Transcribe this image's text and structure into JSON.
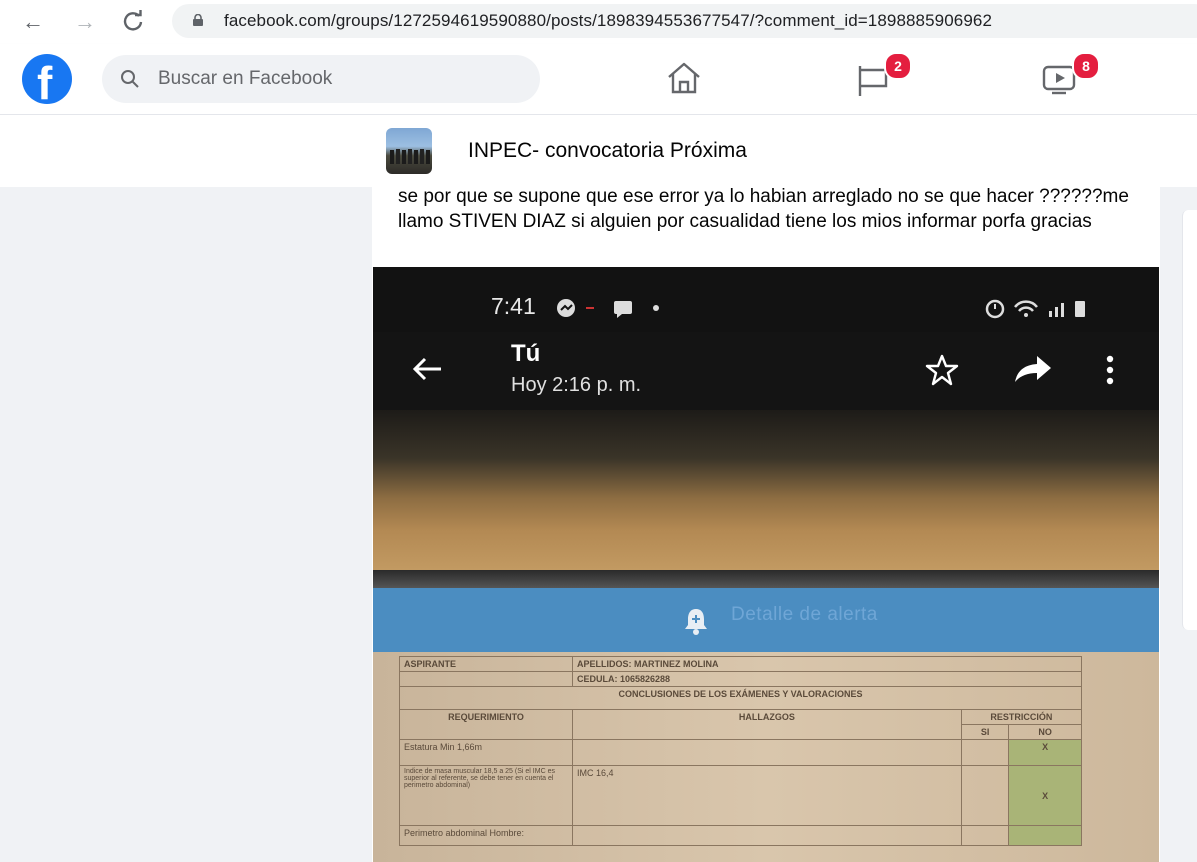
{
  "browser": {
    "url": "facebook.com/groups/1272594619590880/posts/1898394553677547/?comment_id=1898885906962"
  },
  "header": {
    "search_placeholder": "Buscar en Facebook",
    "flag_badge": "2",
    "watch_badge": "8",
    "colors": {
      "brand": "#1877f2",
      "badge": "#e41e3f"
    }
  },
  "group": {
    "title": "INPEC- convocatoria Próxima"
  },
  "post": {
    "text": "se por que se supone que ese error ya lo habian arreglado no se que hacer ??????me llamo STIVEN DIAZ si alguien por casualidad tiene los mios informar porfa gracias"
  },
  "photo": {
    "status_time": "7:41",
    "chat_name": "Tú",
    "chat_time": "Hoy 2:16 p. m.",
    "band_label": "Detalle de alerta",
    "doc": {
      "aspirante_label": "ASPIRANTE",
      "apellidos": "APELLIDOS: MARTINEZ MOLINA",
      "cedula": "CEDULA: 1065826288",
      "conclusiones": "CONCLUSIONES DE LOS EXÁMENES Y VALORACIONES",
      "col_requerimiento": "REQUERIMIENTO",
      "col_hallazgos": "HALLAZGOS",
      "col_restriccion": "RESTRICCIÓN",
      "col_si": "SI",
      "col_no": "NO",
      "row1_req": "Estatura Min 1,66m",
      "row1_no": "X",
      "row2_req": "Indice de masa muscular 18,5 a 25 (Si el IMC es superior al referente, se debe tener en cuenta el perimetro abdominal)",
      "row2_hallazgo": "IMC 16,4",
      "row2_no": "X",
      "row3_req": "Perimetro abdominal Hombre:"
    }
  }
}
